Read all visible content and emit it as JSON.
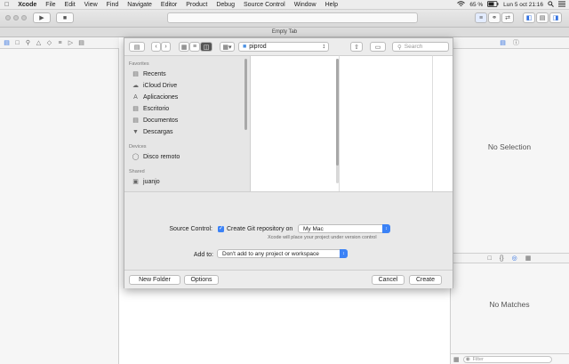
{
  "menubar": {
    "apple": "",
    "items": [
      "Xcode",
      "File",
      "Edit",
      "View",
      "Find",
      "Navigate",
      "Editor",
      "Product",
      "Debug",
      "Source Control",
      "Window",
      "Help"
    ],
    "battery": "65 %",
    "datetime": "Lun 5 oct  21:16"
  },
  "toolbar": {
    "run_icon": "play-icon",
    "stop_icon": "stop-icon"
  },
  "tabbar": {
    "title": "Empty Tab"
  },
  "dialog": {
    "path": "piprod",
    "search_placeholder": "Search",
    "sidebar": {
      "favorites_header": "Favorites",
      "favorites": [
        {
          "label": "Recents",
          "icon": "recents-icon"
        },
        {
          "label": "iCloud Drive",
          "icon": "cloud-icon"
        },
        {
          "label": "Aplicaciones",
          "icon": "applications-icon"
        },
        {
          "label": "Escritorio",
          "icon": "desktop-icon"
        },
        {
          "label": "Documentos",
          "icon": "documents-icon"
        },
        {
          "label": "Descargas",
          "icon": "downloads-icon"
        }
      ],
      "devices_header": "Devices",
      "devices": [
        {
          "label": "Disco remoto",
          "icon": "disc-icon"
        }
      ],
      "shared_header": "Shared",
      "shared": [
        {
          "label": "juanjo",
          "icon": "network-computer-icon"
        }
      ]
    },
    "source_control_label": "Source Control:",
    "create_git_label": "Create Git repository on",
    "create_git_checked": true,
    "git_location": "My Mac",
    "git_note": "Xcode will place your project under version control",
    "add_to_label": "Add to:",
    "add_to_value": "Don't add to any project or workspace",
    "new_folder": "New Folder",
    "options": "Options",
    "cancel": "Cancel",
    "create": "Create"
  },
  "inspector": {
    "no_selection": "No Selection",
    "no_matches": "No Matches",
    "filter_placeholder": "Filter"
  },
  "colors": {
    "accent": "#3b82f6"
  }
}
